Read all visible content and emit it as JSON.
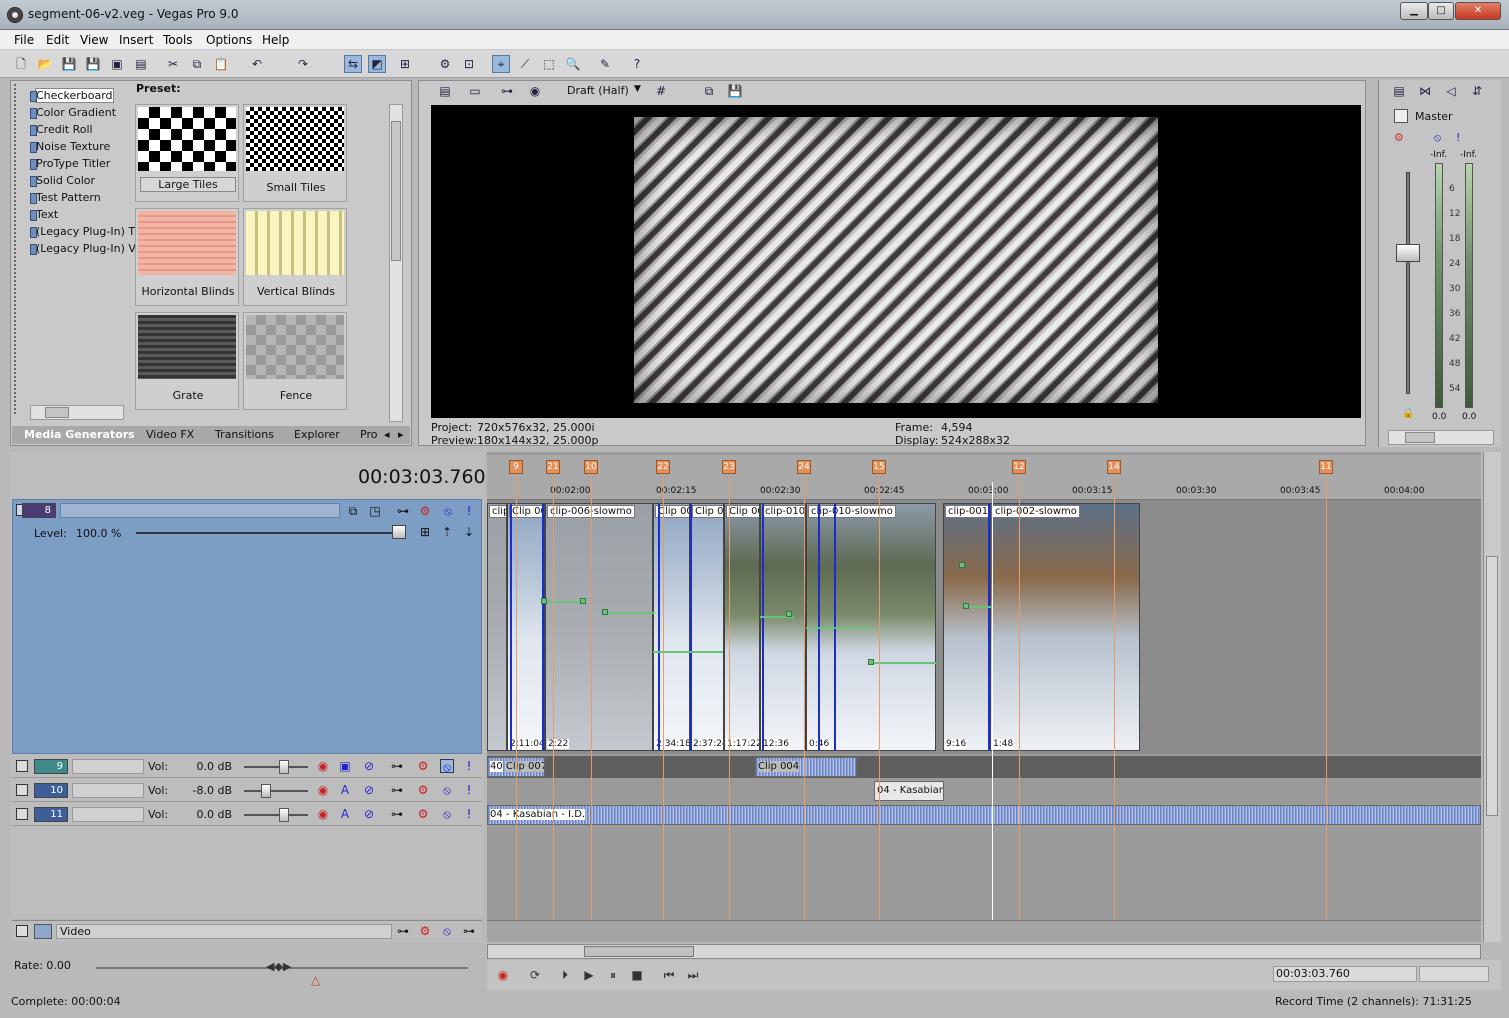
{
  "window": {
    "title": "segment-06-v2.veg - Vegas Pro 9.0"
  },
  "menu": [
    "File",
    "Edit",
    "View",
    "Insert",
    "Tools",
    "Options",
    "Help"
  ],
  "generators": {
    "items": [
      "Checkerboard",
      "Color Gradient",
      "Credit Roll",
      "Noise Texture",
      "ProType Titler",
      "Solid Color",
      "Test Pattern",
      "Text",
      "(Legacy Plug-In) T",
      "(Legacy Plug-In) V"
    ],
    "selected": "Checkerboard",
    "preset_label": "Preset:",
    "presets": [
      "Large Tiles",
      "Small Tiles",
      "Horizontal Blinds",
      "Vertical Blinds",
      "Grate",
      "Fence"
    ]
  },
  "tabs": [
    "Media Generators",
    "Video FX",
    "Transitions",
    "Explorer",
    "Pro"
  ],
  "preview": {
    "quality": "Draft (Half)",
    "project_label": "Project:",
    "project": "720x576x32, 25.000i",
    "preview_label": "Preview:",
    "preview": "180x144x32, 25.000p",
    "frame_label": "Frame:",
    "frame": "4,594",
    "display_label": "Display:",
    "display": "524x288x32"
  },
  "mixer": {
    "label": "Master",
    "left": "-Inf.",
    "right": "-Inf.",
    "scale": [
      "6",
      "12",
      "18",
      "24",
      "30",
      "36",
      "42",
      "48",
      "54"
    ],
    "foot_left": "0.0",
    "foot_right": "0.0"
  },
  "timecode": "00:03:03.760",
  "video_track": {
    "number": "8",
    "level_label": "Level:",
    "level": "100.0 %"
  },
  "audio_tracks": [
    {
      "number": "9",
      "vol_label": "Vol:",
      "vol": "0.0 dB",
      "level": 0.62
    },
    {
      "number": "10",
      "vol_label": "Vol:",
      "vol": "-8.0 dB",
      "level": 0.35
    },
    {
      "number": "11",
      "vol_label": "Vol:",
      "vol": "0.0 dB",
      "level": 0.62
    }
  ],
  "ruler": {
    "ticks": [
      "00:02:00",
      "00:02:15",
      "00:02:30",
      "00:02:45",
      "00:03:00",
      "00:03:15",
      "00:03:30",
      "00:03:45",
      "00:04:00"
    ],
    "markers": [
      "9",
      "21",
      "10",
      "22",
      "23",
      "24",
      "15",
      "12",
      "14",
      "11"
    ]
  },
  "clips": [
    {
      "name": "clip",
      "time": ""
    },
    {
      "name": "Clip 00",
      "time": "2:11:04"
    },
    {
      "name": "clip-006-slowmo",
      "time": "2:22"
    },
    {
      "name": "Clip 00",
      "time": "2:34:18"
    },
    {
      "name": "Clip 00",
      "time": "2:37:24"
    },
    {
      "name": "Clip 00",
      "time": "1:17:22"
    },
    {
      "name": "clip-010",
      "time": "12:36"
    },
    {
      "name": "clip-010-slowmo",
      "time": "0:46"
    },
    {
      "name": "clip-001-",
      "time": "9:16"
    },
    {
      "name": "clip-002-slowmo",
      "time": "1:48"
    }
  ],
  "audio_clips": {
    "t9a": "Clip 007",
    "t9a_prefix": "40",
    "t9b": "Clip 004",
    "t10": "04 - Kasabian",
    "t11": "04 - Kasabian - I.D."
  },
  "bus": {
    "name": "Video"
  },
  "rate": "Rate: 0.00",
  "complete": "Complete: 00:00:04",
  "transport": {
    "time": "00:03:03.760",
    "record": "Record Time (2 channels): 71:31:25"
  },
  "colors": {
    "accent": "#7c9ec5",
    "marker": "#e5905a",
    "envelope": "#67c27a"
  }
}
